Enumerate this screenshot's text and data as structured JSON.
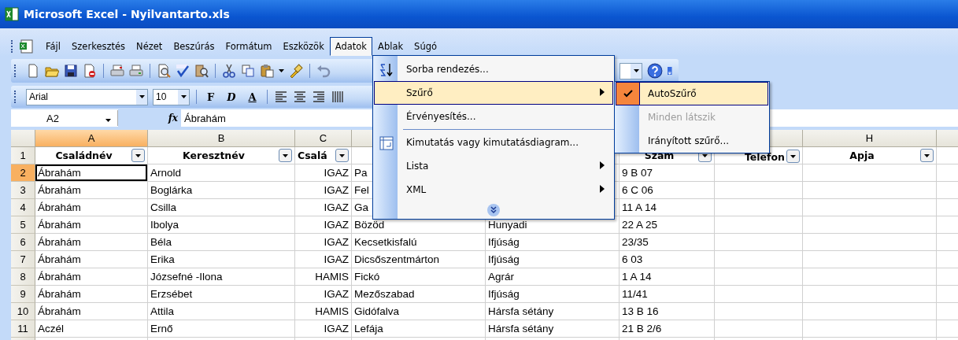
{
  "window": {
    "title": "Microsoft Excel - Nyilvantarto.xls"
  },
  "menu_bar": [
    {
      "label": "Fájl",
      "selected": false
    },
    {
      "label": "Szerkesztés",
      "selected": false
    },
    {
      "label": "Nézet",
      "selected": false
    },
    {
      "label": "Beszúrás",
      "selected": false
    },
    {
      "label": "Formátum",
      "selected": false
    },
    {
      "label": "Eszközök",
      "selected": false
    },
    {
      "label": "Adatok",
      "selected": true
    },
    {
      "label": "Ablak",
      "selected": false
    },
    {
      "label": "Súgó",
      "selected": false
    }
  ],
  "formatting_toolbar": {
    "font": "Arial",
    "size": "10",
    "buttons": [
      "F",
      "D",
      "A"
    ]
  },
  "formula_bar": {
    "name_box": "A2",
    "fx": "fx",
    "value": "Ábrahám"
  },
  "columns": [
    {
      "letter": "A",
      "selected": true
    },
    {
      "letter": "B",
      "selected": false
    },
    {
      "letter": "C",
      "selected": false
    },
    null,
    null,
    null,
    null,
    {
      "letter": "H",
      "selected": false
    },
    null
  ],
  "header_row": {
    "number": "1",
    "selected": false,
    "cells": [
      {
        "text": "Családnév",
        "filter": true
      },
      {
        "text": "Keresztnév",
        "filter": true
      },
      {
        "text": "Csalá",
        "filter": true
      },
      null,
      null,
      {
        "text": "Szam",
        "filter": true
      },
      {
        "text": "Telefon",
        "filter": true
      },
      {
        "text": "Apja",
        "filter": true
      }
    ]
  },
  "rows": [
    {
      "number": "2",
      "selected": true,
      "cells": [
        "Ábrahám",
        "Arnold",
        "IGAZ",
        "Pa",
        null,
        "9 B 07",
        null,
        null
      ]
    },
    {
      "number": "3",
      "selected": false,
      "cells": [
        "Ábrahám",
        "Boglárka",
        "IGAZ",
        "Fel",
        null,
        "6 C 06",
        null,
        null
      ]
    },
    {
      "number": "4",
      "selected": false,
      "cells": [
        "Ábrahám",
        "Csilla",
        "IGAZ",
        "Ga",
        null,
        "11 A 14",
        null,
        null
      ]
    },
    {
      "number": "5",
      "selected": false,
      "cells": [
        "Ábrahám",
        "Ibolya",
        "IGAZ",
        "Bözöd",
        "Hunyadi",
        "22 A 25",
        null,
        null
      ]
    },
    {
      "number": "6",
      "selected": false,
      "cells": [
        "Ábrahám",
        "Béla",
        "IGAZ",
        "Kecsetkisfalú",
        "Ifjúság",
        "23/35",
        null,
        null
      ]
    },
    {
      "number": "7",
      "selected": false,
      "cells": [
        "Ábrahám",
        "Erika",
        "IGAZ",
        "Dicsőszentmárton",
        "Ifjúság",
        "6 03",
        null,
        null
      ]
    },
    {
      "number": "8",
      "selected": false,
      "cells": [
        "Ábrahám",
        "Józsefné -Ilona",
        "HAMIS",
        "Fickó",
        "Agrár",
        "1 A 14",
        null,
        null
      ]
    },
    {
      "number": "9",
      "selected": false,
      "cells": [
        "Ábrahám",
        "Erzsébet",
        "IGAZ",
        "Mezőszabad",
        "Ifjúság",
        "11/41",
        null,
        null
      ]
    },
    {
      "number": "10",
      "selected": false,
      "cells": [
        "Ábrahám",
        "Attila",
        "HAMIS",
        "Gidófalva",
        "Hársfa sétány",
        "13 B 16",
        null,
        null
      ]
    },
    {
      "number": "11",
      "selected": false,
      "cells": [
        "Aczél",
        "Ernő",
        "IGAZ",
        "Lefája",
        "Hársfa sétány",
        "21 B 2/6",
        null,
        null
      ]
    }
  ],
  "data_menu": {
    "items": [
      {
        "kind": "item",
        "label": "Sorba rendezés...",
        "selected": false,
        "submenu": false
      },
      {
        "kind": "item",
        "label": "Szűrő",
        "selected": true,
        "submenu": true
      },
      {
        "kind": "item",
        "label": "Érvényesítés...",
        "selected": false,
        "submenu": false
      },
      {
        "kind": "separator"
      },
      {
        "kind": "item",
        "label": "Kimutatás vagy kimutatásdiagram...",
        "selected": false,
        "submenu": false
      },
      {
        "kind": "item",
        "label": "Lista",
        "selected": false,
        "submenu": true
      },
      {
        "kind": "item",
        "label": "XML",
        "selected": false,
        "submenu": true
      },
      {
        "kind": "expand"
      }
    ]
  },
  "filter_submenu": {
    "items": [
      {
        "label": "AutoSzűrő",
        "checked": true,
        "selected": true,
        "disabled": false
      },
      {
        "label": "Minden látszik",
        "checked": false,
        "selected": false,
        "disabled": true
      },
      {
        "label": "Irányított szűrő...",
        "checked": false,
        "selected": false,
        "disabled": false
      }
    ]
  }
}
